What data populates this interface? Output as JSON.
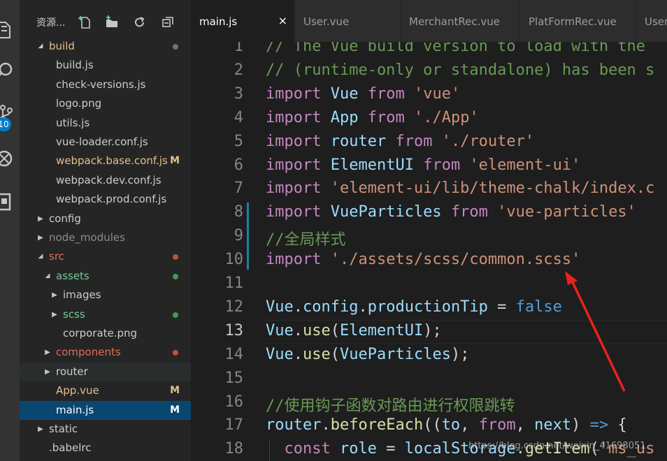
{
  "activity_bar": {
    "icons": [
      "explorer-icon",
      "search-icon",
      "source-control-icon",
      "debug-icon",
      "extensions-icon"
    ],
    "scm_badge": "10"
  },
  "sidebar": {
    "title": "资源...",
    "actions": [
      "new-file-icon",
      "new-folder-icon",
      "refresh-icon",
      "collapse-all-icon"
    ],
    "tree": [
      {
        "label": "build",
        "expanded": true,
        "dot_color": "#8c6a57",
        "color": "#e2c08d"
      },
      {
        "label": "build.js"
      },
      {
        "label": "check-versions.js"
      },
      {
        "label": "logo.png"
      },
      {
        "label": "utils.js"
      },
      {
        "label": "vue-loader.conf.js"
      },
      {
        "label": "webpack.base.conf.js",
        "status": "M",
        "color": "#e2c08d"
      },
      {
        "label": "webpack.dev.conf.js"
      },
      {
        "label": "webpack.prod.conf.js"
      },
      {
        "label": "config",
        "expanded": false
      },
      {
        "label": "node_modules",
        "expanded": false,
        "color": "#8c8c8c"
      },
      {
        "label": "src",
        "expanded": true,
        "dot_color": "#c74e39",
        "color": "#e06c5a"
      },
      {
        "label": "assets",
        "expanded": true,
        "dot_color": "#3e9d4e",
        "color": "#73c991"
      },
      {
        "label": "images",
        "expanded": false
      },
      {
        "label": "scss",
        "expanded": false,
        "dot_color": "#3e9d4e",
        "color": "#73c991"
      },
      {
        "label": "corporate.png"
      },
      {
        "label": "components",
        "expanded": false,
        "dot_color": "#c74e39",
        "color": "#e06c5a"
      },
      {
        "label": "router",
        "expanded": false
      },
      {
        "label": "App.vue",
        "status": "M",
        "color": "#e2c08d"
      },
      {
        "label": "main.js",
        "status": "M",
        "color": "#ffffff",
        "selected": true
      },
      {
        "label": "static",
        "expanded": false
      },
      {
        "label": ".babelrc"
      }
    ]
  },
  "tabs": [
    {
      "label": "main.js",
      "active": true,
      "close": "×"
    },
    {
      "label": "User.vue"
    },
    {
      "label": "MerchantRec.vue"
    },
    {
      "label": "PlatFormRec.vue"
    },
    {
      "label": "User"
    }
  ],
  "editor": {
    "current_line": 13,
    "lines": [
      {
        "n": "1",
        "code": "// The Vue build version to load with the"
      },
      {
        "n": "2",
        "code": "// (runtime-only or standalone) has been s"
      },
      {
        "n": "3",
        "code": "import Vue from 'vue'"
      },
      {
        "n": "4",
        "code": "import App from './App'"
      },
      {
        "n": "5",
        "code": "import router from './router'"
      },
      {
        "n": "6",
        "code": "import ElementUI from 'element-ui'"
      },
      {
        "n": "7",
        "code": "import 'element-ui/lib/theme-chalk/index.c"
      },
      {
        "n": "8",
        "code": "import VueParticles from 'vue-particles'"
      },
      {
        "n": "9",
        "code": "//全局样式"
      },
      {
        "n": "10",
        "code": "import './assets/scss/common.scss'"
      },
      {
        "n": "11",
        "code": ""
      },
      {
        "n": "12",
        "code": "Vue.config.productionTip = false"
      },
      {
        "n": "13",
        "code": "Vue.use(ElementUI);"
      },
      {
        "n": "14",
        "code": "Vue.use(VueParticles);"
      },
      {
        "n": "15",
        "code": ""
      },
      {
        "n": "16",
        "code": "//使用钩子函数对路由进行权限跳转"
      },
      {
        "n": "17",
        "code": "router.beforeEach((to, from, next) => {"
      },
      {
        "n": "18",
        "code": "  const role = localStorage.getItem('ms_us"
      }
    ],
    "syntax_colors": {
      "comment": "#6a9955",
      "keyword": "#c586c0",
      "identifier": "#9cdcfe",
      "string": "#ce9178",
      "plain": "#d4d4d4",
      "function": "#dcdcaa",
      "boolean": "#569cd6"
    }
  },
  "watermark": "https://blog.csdn.net/weixin_41698051",
  "annotation": {
    "arrow_color": "#e8231e"
  }
}
